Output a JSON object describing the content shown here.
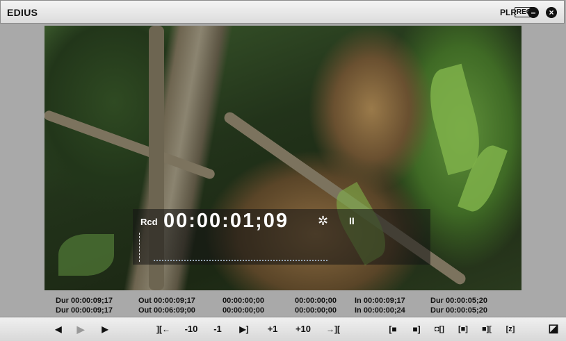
{
  "window": {
    "title": "EDIUS",
    "plr_label": "PLR",
    "rec_label": "REC"
  },
  "overlay": {
    "rcd_label": "Rcd",
    "timecode": "00:00:01;09",
    "star": "✲",
    "pause": "II"
  },
  "info": {
    "c1": [
      "Dur 00:00:09;17",
      "Dur 00:00:09;17"
    ],
    "c2": [
      "Out 00:00:09;17",
      "Out 00:06:09;00"
    ],
    "c3": [
      "00:00:00;00",
      "00:00:00;00"
    ],
    "c4": [
      "00:00:00;00",
      "00:00:00;00"
    ],
    "c5": [
      "In 00:00:09;17",
      "In 00:00:00;24"
    ],
    "c6": [
      "Dur 00:00:05;20",
      "Dur 00:00:05;20"
    ]
  },
  "controls": {
    "prev": "◀",
    "play": "▶",
    "next": "▶",
    "goto_in": "][←",
    "minus10": "-10",
    "minus1": "-1",
    "step_out": "▶]",
    "plus1": "+1",
    "plus10": "+10",
    "goto_out": "→][",
    "set_in": "[■",
    "set_out": "■]",
    "split_in_out": "◘[]",
    "insert": "[■]",
    "overwrite": "■][",
    "zoom": "[z]",
    "toggle": "◪"
  },
  "icons": [
    "minimize-icon",
    "close-icon"
  ]
}
